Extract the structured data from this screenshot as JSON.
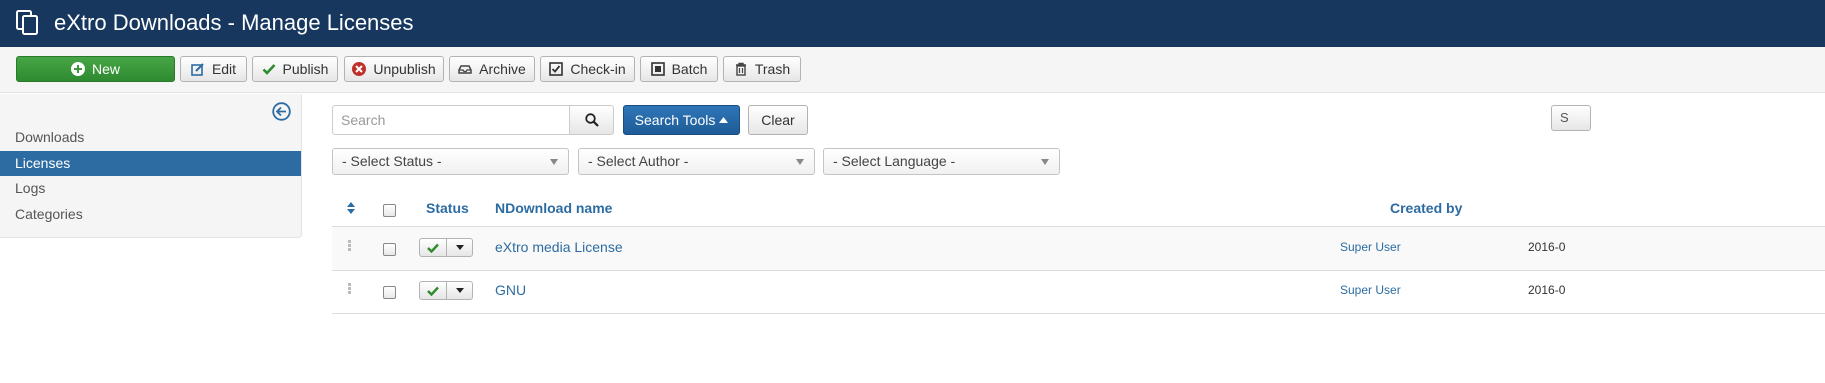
{
  "header": {
    "title": "eXtro Downloads - Manage Licenses",
    "icon": "copy-icon"
  },
  "toolbar": {
    "new_label": "New",
    "edit_label": "Edit",
    "publish_label": "Publish",
    "unpublish_label": "Unpublish",
    "archive_label": "Archive",
    "checkin_label": "Check-in",
    "batch_label": "Batch",
    "trash_label": "Trash"
  },
  "sidebar": {
    "items": [
      {
        "label": "Downloads",
        "active": false
      },
      {
        "label": "Licenses",
        "active": true
      },
      {
        "label": "Logs",
        "active": false
      },
      {
        "label": "Categories",
        "active": false
      }
    ]
  },
  "filters": {
    "search_placeholder": "Search",
    "search_tools_label": "Search Tools",
    "clear_label": "Clear",
    "right_partial_label": "S",
    "status_select": "- Select Status -",
    "author_select": "- Select Author -",
    "language_select": "- Select Language -"
  },
  "table": {
    "headers": {
      "status": "Status",
      "name": "NDownload name",
      "created_by": "Created by"
    },
    "rows": [
      {
        "name": "eXtro media License",
        "author": "Super User",
        "date": "2016-0",
        "published": true
      },
      {
        "name": "GNU",
        "author": "Super User",
        "date": "2016-0",
        "published": true
      }
    ]
  },
  "colors": {
    "header_bg": "#17375e",
    "accent": "#2d6ca2",
    "new_button": "#3c9a3c",
    "published_check": "#2e8b2e"
  }
}
